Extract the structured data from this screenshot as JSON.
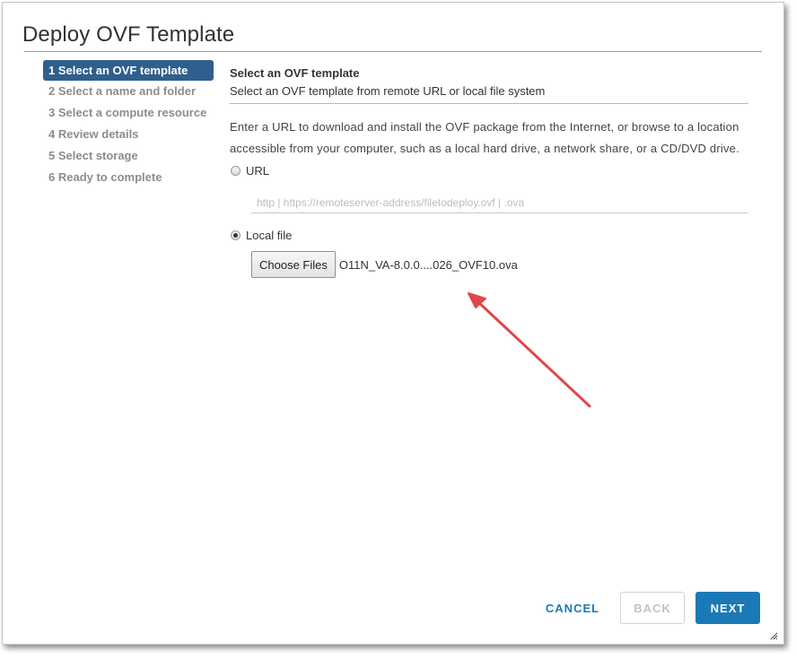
{
  "dialog": {
    "title": "Deploy OVF Template"
  },
  "steps": [
    {
      "label": "1 Select an OVF template",
      "active": true
    },
    {
      "label": "2 Select a name and folder",
      "active": false
    },
    {
      "label": "3 Select a compute resource",
      "active": false
    },
    {
      "label": "4 Review details",
      "active": false
    },
    {
      "label": "5 Select storage",
      "active": false
    },
    {
      "label": "6 Ready to complete",
      "active": false
    }
  ],
  "content": {
    "heading": "Select an OVF template",
    "subheading": "Select an OVF template from remote URL or local file system",
    "description": "Enter a URL to download and install the OVF package from the Internet, or browse to a location accessible from your computer, such as a local hard drive, a network share, or a CD/DVD drive.",
    "url_option": {
      "label": "URL",
      "selected": false,
      "placeholder": "http | https://remoteserver-address/filetodeploy.ovf | .ova",
      "value": ""
    },
    "local_option": {
      "label": "Local file",
      "selected": true,
      "choose_button": "Choose Files",
      "file_name": "O11N_VA-8.0.0....026_OVF10.ova"
    }
  },
  "footer": {
    "cancel": "CANCEL",
    "back": "BACK",
    "next": "NEXT"
  },
  "colors": {
    "active_step_bg": "#2f5f8c",
    "primary": "#1b79b8",
    "annotation_arrow": "#e0474c"
  }
}
